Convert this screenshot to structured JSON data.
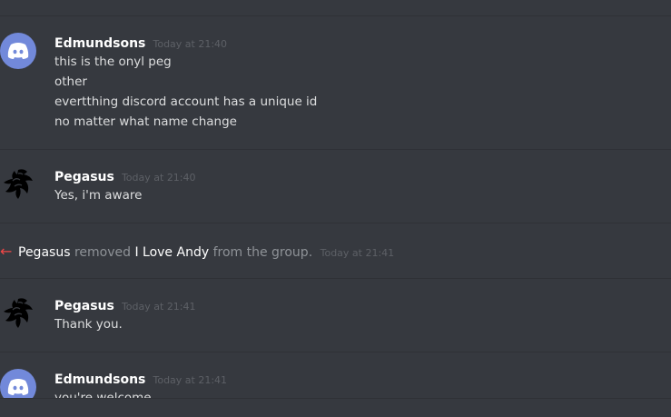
{
  "messages": [
    {
      "username": "Edmundsons",
      "timestamp": "Today at 21:40",
      "avatar_icon": "discord-logo-icon",
      "lines": [
        "this is the onyl peg",
        "other",
        "evertthing discord account has a unique id",
        "no matter what name change"
      ]
    },
    {
      "username": "Pegasus",
      "timestamp": "Today at 21:40",
      "avatar_icon": "pegasus-avatar-icon",
      "lines": [
        "Yes, i'm aware"
      ]
    },
    {
      "username": "Pegasus",
      "timestamp": "Today at 21:41",
      "avatar_icon": "pegasus-avatar-icon",
      "lines": [
        "Thank you."
      ]
    },
    {
      "username": "Edmundsons",
      "timestamp": "Today at 21:41",
      "avatar_icon": "discord-logo-icon",
      "lines": [
        "you're welcome"
      ]
    }
  ],
  "system_message": {
    "actor": "Pegasus",
    "action": "removed",
    "target": "I Love Andy",
    "suffix": "from the group.",
    "timestamp": "Today at 21:41",
    "icon": "left-arrow-icon"
  },
  "colors": {
    "background": "#36393f",
    "discord_blurple": "#7289da",
    "system_arrow": "#f04747"
  }
}
